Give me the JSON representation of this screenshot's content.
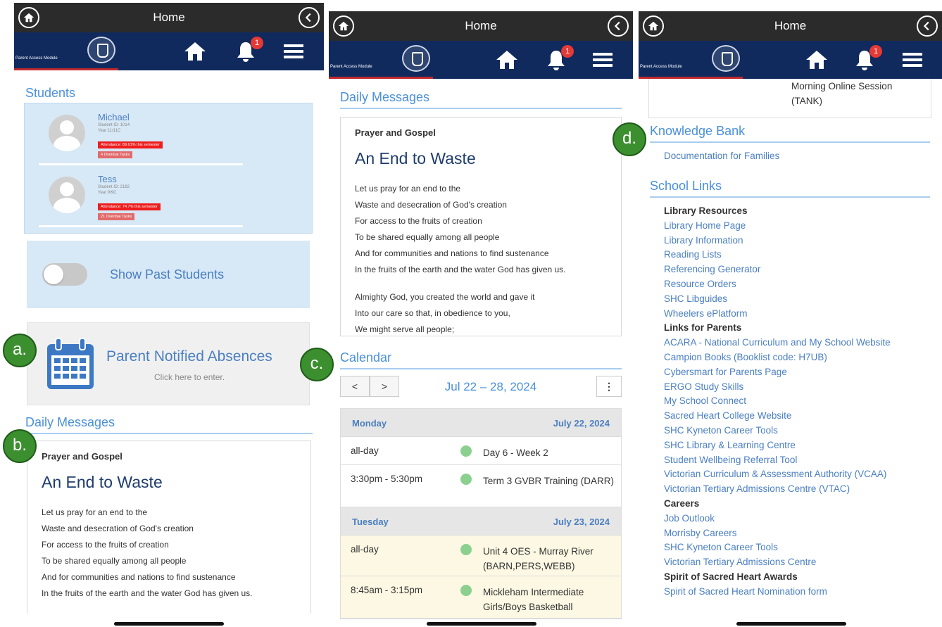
{
  "screen_title": "Home",
  "brand_name": "Parent Access Module",
  "notification_count": "1",
  "students_section": {
    "heading": "Students",
    "students": [
      {
        "name": "Michael",
        "student_id": "Student ID: 1014",
        "year": "Year 11/11C",
        "attendance": "Attendance: 89.61% this semester",
        "overdue": "4 Overdue Tasks"
      },
      {
        "name": "Tess",
        "student_id": "Student ID: 2182",
        "year": "Year 9/9C",
        "attendance": "Attendance: 74.7% this semester",
        "overdue": "21 Overdue Tasks"
      }
    ],
    "show_past_label": "Show Past Students"
  },
  "absences": {
    "title": "Parent Notified Absences",
    "subtitle": "Click here to enter."
  },
  "daily_messages": {
    "heading": "Daily Messages",
    "category": "Prayer and Gospel",
    "title": "An End to Waste",
    "lines": [
      "Let us pray for an end to the",
      " Waste and desecration of God's creation",
      " For access to the fruits of creation",
      " To be shared equally among all people",
      " And for communities and nations to find sustenance",
      " In the fruits of the earth and the water God has given us."
    ],
    "lines2": [
      "Almighty God, you created the world and gave it",
      " Into our care so that, in obedience to you,",
      " We might serve all people;"
    ]
  },
  "calendar": {
    "heading": "Calendar",
    "prev": "<",
    "next": ">",
    "range": "Jul 22 – 28, 2024",
    "more": "⋮",
    "days": [
      {
        "day": "Monday",
        "date": "July 22, 2024",
        "events": [
          {
            "time": "all-day",
            "title": "Day 6 - Week 2"
          },
          {
            "time": "3:30pm - 5:30pm",
            "title": "Term 3 GVBR Training (DARR)"
          }
        ]
      },
      {
        "day": "Tuesday",
        "date": "July 23, 2024",
        "events": [
          {
            "time": "all-day",
            "title": "Unit 4 OES - Murray River (BARN,PERS,WEBB)"
          },
          {
            "time": "8:45am - 3:15pm",
            "title": "Mickleham Intermediate Girls/Boys Basketball"
          }
        ]
      }
    ]
  },
  "prev_event": {
    "line1": "Morning Online Session",
    "line2": "(TANK)"
  },
  "knowledge_bank": {
    "heading": "Knowledge Bank",
    "links": [
      "Documentation for Families"
    ]
  },
  "school_links": {
    "heading": "School Links",
    "groups": [
      {
        "name": "Library Resources",
        "links": [
          "Library Home Page",
          "Library Information",
          "Reading Lists",
          "Referencing Generator",
          "Resource Orders",
          "SHC Libguides",
          "Wheelers ePlatform"
        ]
      },
      {
        "name": "Links for Parents",
        "links": [
          "ACARA - National Curriculum and My School Website",
          "Campion Books (Booklist code: H7UB)",
          "Cybersmart for Parents Page",
          "ERGO Study Skills",
          "My School Connect",
          "Sacred Heart College Website",
          "SHC Kyneton Career Tools",
          "SHC Library & Learning Centre",
          "Student Wellbeing Referral Tool",
          "Victorian Curriculum & Assessment Authority (VCAA)",
          "Victorian Tertiary Admissions Centre (VTAC)"
        ]
      },
      {
        "name": "Careers",
        "links": [
          "Job Outlook",
          "Morrisby Careers",
          "SHC Kyneton Career Tools",
          "Victorian Tertiary Admissions Centre"
        ]
      },
      {
        "name": "Spirit of Sacred Heart Awards",
        "links": [
          "Spirit of Sacred Heart Nomination form"
        ]
      }
    ]
  },
  "markers": [
    "a.",
    "b.",
    "c.",
    "d."
  ],
  "icons": [
    "home-circle-icon",
    "back-circle-icon",
    "house-icon",
    "bell-icon",
    "menu-icon",
    "calendar-icon",
    "avatar-icon"
  ],
  "colors": {
    "header_dark": "#2b2b2b",
    "navbar_navy": "#102a5e",
    "accent_blue": "#4a90d9",
    "marker_green": "#3c8f2f"
  }
}
